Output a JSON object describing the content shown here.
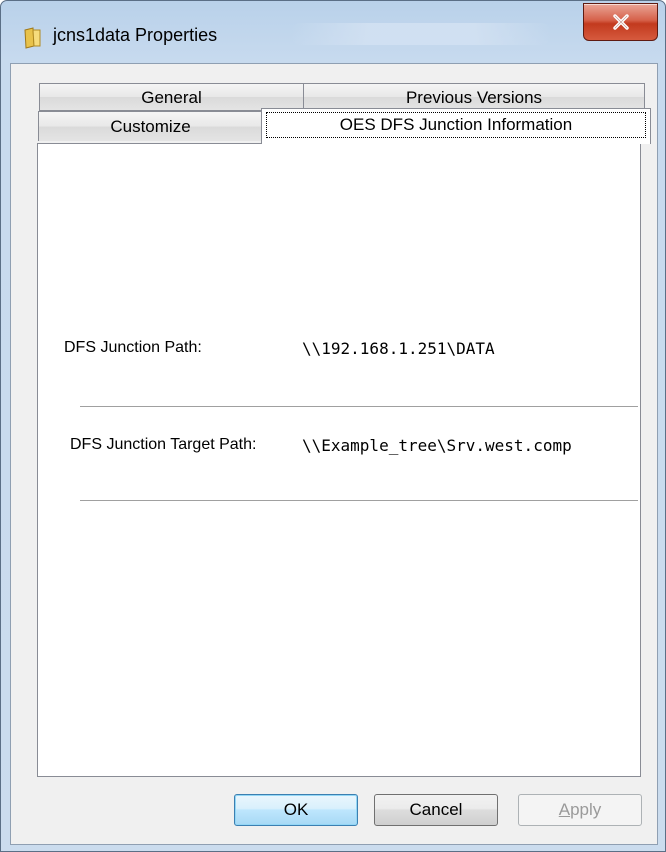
{
  "window": {
    "title": "jcns1data Properties",
    "close_glyph": "X",
    "icons": {
      "folder": "folder-icon",
      "close": "close-icon"
    }
  },
  "tabs": {
    "row1": [
      {
        "label": "General"
      },
      {
        "label": "Previous Versions"
      }
    ],
    "row2": [
      {
        "label": "Customize"
      },
      {
        "label": "OES DFS Junction Information",
        "active": true
      }
    ]
  },
  "panel": {
    "junction_path_label": "DFS Junction Path:",
    "junction_path_value": "\\\\192.168.1.251\\DATA",
    "target_path_label": "DFS Junction Target Path:",
    "target_path_value": "\\\\Example_tree\\Srv.west.comp"
  },
  "buttons": {
    "ok": "OK",
    "cancel": "Cancel",
    "apply_mnemonic": "A",
    "apply_rest": "pply",
    "apply_enabled": false
  },
  "colors": {
    "close_button": "#c23a1e",
    "ok_border": "#3c7fb1",
    "disabled_text": "#9a9a9a"
  }
}
